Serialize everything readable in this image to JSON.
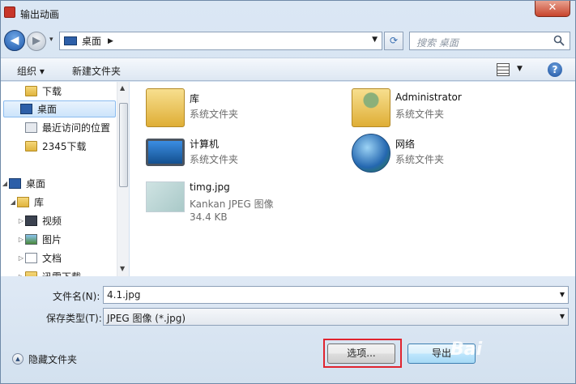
{
  "window": {
    "title": "输出动画",
    "close_glyph": "✕"
  },
  "nav": {
    "back_glyph": "◀",
    "forward_glyph": "▶",
    "address": "桌面",
    "search_placeholder": "搜索 桌面"
  },
  "toolbar": {
    "organize": "组织 ▾",
    "new_folder": "新建文件夹",
    "help_glyph": "?"
  },
  "sidebar": {
    "items": [
      {
        "label": "下载",
        "icon": "download-folder-icon"
      },
      {
        "label": "桌面",
        "icon": "desktop-icon",
        "selected": true
      },
      {
        "label": "最近访问的位置",
        "icon": "recent-places-icon"
      },
      {
        "label": "2345下载",
        "icon": "folder-icon"
      },
      {
        "label": "桌面",
        "icon": "desktop-icon",
        "expanded": true
      },
      {
        "label": "库",
        "icon": "library-icon",
        "expanded": true
      },
      {
        "label": "视频",
        "icon": "video-library-icon"
      },
      {
        "label": "图片",
        "icon": "pictures-library-icon"
      },
      {
        "label": "文档",
        "icon": "documents-library-icon"
      },
      {
        "label": "迅雷下载",
        "icon": "folder-icon"
      }
    ]
  },
  "files": [
    {
      "name": "库",
      "type": "系统文件夹",
      "icon": "library-folder-icon"
    },
    {
      "name": "Administrator",
      "type": "系统文件夹",
      "icon": "user-folder-icon"
    },
    {
      "name": "计算机",
      "type": "系统文件夹",
      "icon": "computer-icon"
    },
    {
      "name": "网络",
      "type": "系统文件夹",
      "icon": "network-icon"
    },
    {
      "name": "timg.jpg",
      "type": "Kankan JPEG 图像",
      "size": "34.4 KB",
      "icon": "jpeg-thumbnail-icon"
    }
  ],
  "form": {
    "filename_label": "文件名(N):",
    "filename_value": "4.1.jpg",
    "filetype_label": "保存类型(T):",
    "filetype_value": "JPEG 图像 (*.jpg)"
  },
  "footer": {
    "hide_folders": "隐藏文件夹",
    "options_button": "选项...",
    "save_button": "导出"
  },
  "watermark": "Bai"
}
